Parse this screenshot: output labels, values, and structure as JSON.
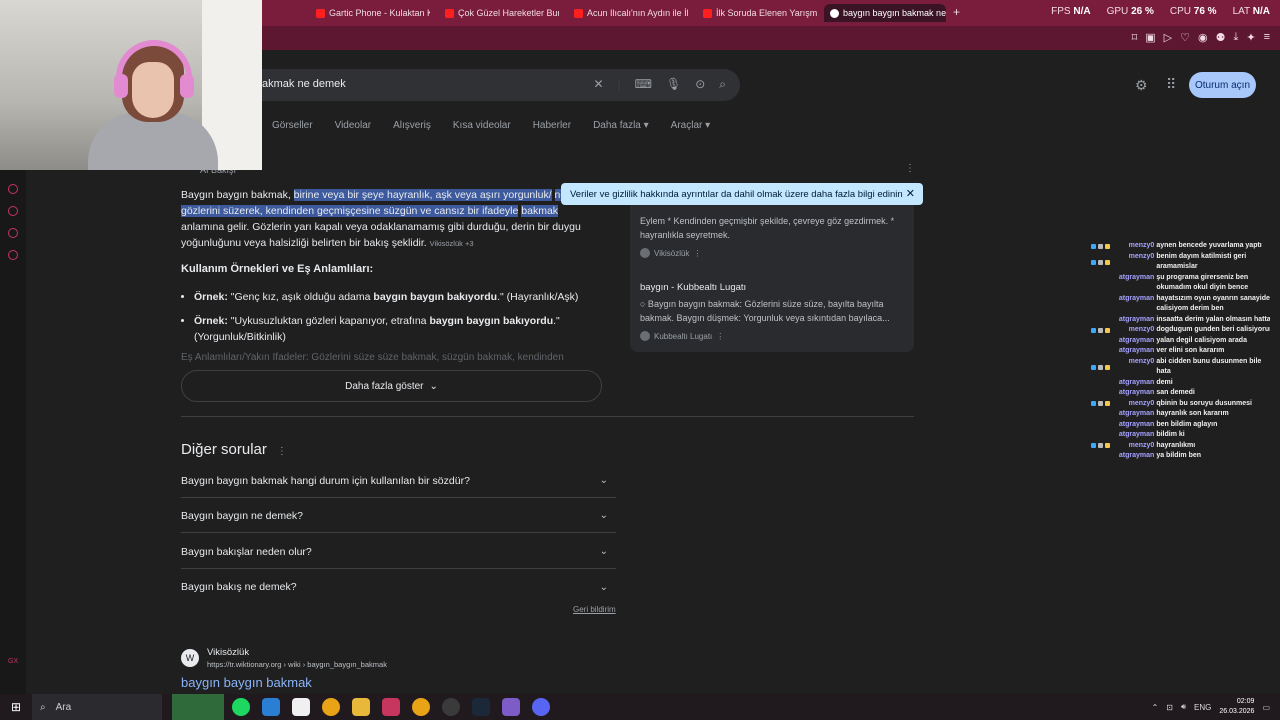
{
  "browser": {
    "tabs": [
      {
        "label": "Gartic Phone - Kulaktan K"
      },
      {
        "label": "Çok Güzel Hareketler Bun"
      },
      {
        "label": "Acun Ilıcalı'nın Aydın ile İlş"
      },
      {
        "label": "İlk Soruda Elenen Yarışmac"
      },
      {
        "label": "baygın baygın bakmak ne",
        "active": true
      }
    ],
    "new_tab": "+",
    "stats": {
      "fps_label": "FPS",
      "fps_value": "N/A",
      "gpu_label": "GPU",
      "gpu_value": "26 %",
      "cpu_label": "CPU",
      "cpu_value": "76 %",
      "lat_label": "LAT",
      "lat_value": "N/A"
    }
  },
  "google": {
    "search_query": "akmak ne demek",
    "signin": "Oturum açın",
    "filters": [
      "Görseller",
      "Videolar",
      "Alışveriş",
      "Kısa videolar",
      "Haberler",
      "Daha fazla ▾",
      "Araçlar ▾"
    ],
    "ai_overview_label": "AI Bakışı",
    "overview": {
      "lead": "Baygın baygın bakmak,",
      "highlight1": "birine veya bir şeye hayranlık, aşk veya aşırı yorgunluk/",
      "highlight2": "nedeniyle gözlerini süzerek, kendinden geçmişçesine süzgün ve cansız bir ifadeyle",
      "highlight3": "bakmak",
      "rest": "anlamına gelir. Gözlerin yarı kapalı veya odaklanamamış gibi durduğu, derin bir duygu yoğunluğunu veya halsizliği belirten bir bakış şeklidir.",
      "chip": "Vikisözlük +3"
    },
    "usage_heading": "Kullanım Örnekleri ve Eş Anlamlıları:",
    "examples": [
      {
        "label": "Örnek:",
        "pre": "\"Genç kız, aşık olduğu adama ",
        "bold": "baygın baygın bakıyordu",
        "post": ".\" (Hayranlık/Aşk)"
      },
      {
        "label": "Örnek:",
        "pre": "\"Uykusuzluktan gözleri kapanıyor, etrafına ",
        "bold": "baygın baygın bakıyordu",
        "post": ".\" (Yorgunluk/Bitkinlik)"
      }
    ],
    "faded_line": "Eş Anlamlıları/Yakın İfadeler: Gözlerini süze süze bakmak, süzgün bakmak, kendinden",
    "show_more": "Daha fazla göster",
    "tooltip": "Veriler ve gizlilik hakkında ayrıntılar da dahil olmak üzere daha fazla bilgi edinin",
    "panel": {
      "snippet1": "Eylem * Kendinden geçmişbir şekilde, çevreye göz gezdirmek. * hayranlıkla seyretmek.",
      "source1": "Vikisözlük",
      "title2": "baygın - Kubbealtı Lugatı",
      "snippet2": "○ Baygın baygın bakmak: Gözlerini süze süze, bayılta bayılta bakmak. Baygın düşmek: Yorgunluk veya sıkıntıdan bayılaca...",
      "source2": "Kubbealtı Lugatı"
    },
    "other_questions_heading": "Diğer sorular",
    "faqs": [
      "Baygın baygın bakmak hangi durum için kullanılan bir sözdür?",
      "Baygın baygın ne demek?",
      "Baygın bakışlar neden olur?",
      "Baygın bakış ne demek?"
    ],
    "feedback": "Geri bildirim",
    "result": {
      "site": "Vikisözlük",
      "url": "https://tr.wiktionary.org › wiki › baygın_baygın_bakmak",
      "title": "baygın baygın bakmak"
    }
  },
  "chat": [
    {
      "user": "menzy0",
      "msg": "aynen bencede yuvarlama yaptı"
    },
    {
      "user": "menzy0",
      "msg": "benim dayım katilmisti geri aramamislar"
    },
    {
      "user": "atgrayman",
      "msg": "şu programa girerseniz ben okumadım okul diyin bence"
    },
    {
      "user": "atgrayman",
      "msg": "hayatsızım oyun oyanrın sanayide calisiyom derim ben"
    },
    {
      "user": "atgrayman",
      "msg": "insaatta derim yalan olmasın hatta"
    },
    {
      "user": "menzy0",
      "msg": "dogdugum gunden beri calisiyorum"
    },
    {
      "user": "atgrayman",
      "msg": "yalan degil calisiyom arada"
    },
    {
      "user": "atgrayman",
      "msg": "ver elini son kararım"
    },
    {
      "user": "menzy0",
      "msg": "abi cidden bunu dusunmen bile hata"
    },
    {
      "user": "atgrayman",
      "msg": "demi"
    },
    {
      "user": "atgrayman",
      "msg": "san demedi"
    },
    {
      "user": "menzy0",
      "msg": "qbinin bu soruyu dusunmesi"
    },
    {
      "user": "atgrayman",
      "msg": "hayranlık son kararım"
    },
    {
      "user": "atgrayman",
      "msg": "ben bildim aglayın"
    },
    {
      "user": "atgrayman",
      "msg": "bildim ki"
    },
    {
      "user": "menzy0",
      "msg": "hayranlıkmı"
    },
    {
      "user": "atgrayman",
      "msg": "ya bildim ben"
    }
  ],
  "taskbar": {
    "search_placeholder": "Ara",
    "time": "02:09",
    "date": "26.03.2026"
  },
  "colors": {
    "browser_accent": "#7a1d3c",
    "signin_button": "#a8c7fa",
    "highlight": "#3d5a9e",
    "link": "#8ab4f8"
  }
}
